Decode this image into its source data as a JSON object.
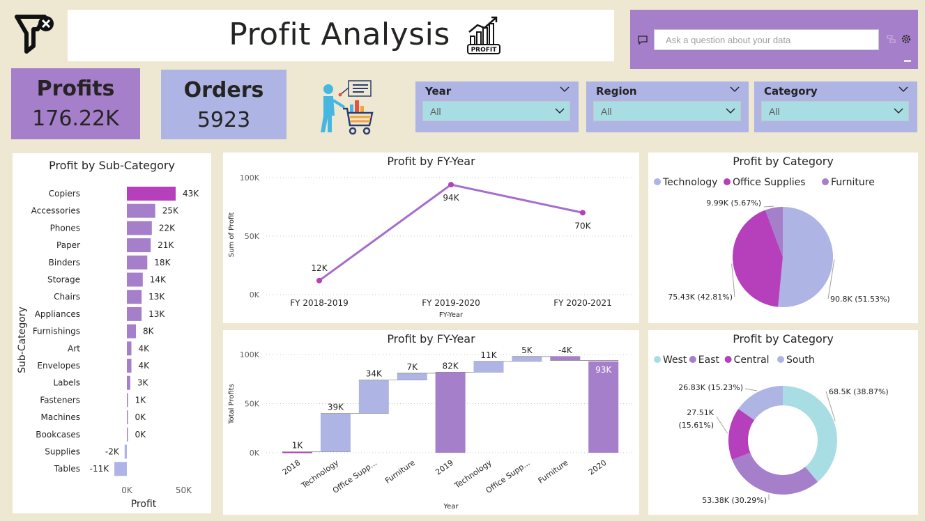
{
  "header": {
    "title": "Profit Analysis",
    "profit_icon_text": "PROFIT"
  },
  "qa": {
    "placeholder": "Ask a question about your data"
  },
  "kpis": {
    "profits": {
      "label": "Profits",
      "value": "176.22K"
    },
    "orders": {
      "label": "Orders",
      "value": "5923"
    }
  },
  "slicers": [
    {
      "label": "Year",
      "value": "All"
    },
    {
      "label": "Region",
      "value": "All"
    },
    {
      "label": "Category",
      "value": "All"
    }
  ],
  "colors": {
    "background": "#eee8d3",
    "purple": "#a67fcb",
    "periwinkle": "#aeb4e4",
    "teal": "#a9dde4",
    "magenta": "#b63fbb",
    "line": "#a66ccf"
  },
  "chart_data": [
    {
      "type": "bar",
      "orientation": "horizontal",
      "title": "Profit by Sub-Category",
      "xlabel": "Profit",
      "ylabel": "Sub-Category",
      "categories": [
        "Copiers",
        "Accessories",
        "Phones",
        "Paper",
        "Binders",
        "Storage",
        "Chairs",
        "Appliances",
        "Furnishings",
        "Art",
        "Envelopes",
        "Labels",
        "Fasteners",
        "Machines",
        "Bookcases",
        "Supplies",
        "Tables"
      ],
      "values": [
        43,
        25,
        22,
        21,
        18,
        14,
        13,
        13,
        8,
        4,
        4,
        3,
        1,
        0,
        0,
        -2,
        -11
      ],
      "data_labels": [
        "43K",
        "25K",
        "22K",
        "21K",
        "18K",
        "14K",
        "13K",
        "13K",
        "8K",
        "4K",
        "4K",
        "3K",
        "1K",
        "0K",
        "0K",
        "-2K",
        "-11K"
      ],
      "x_ticks": [
        "0K",
        "50K"
      ],
      "xlim": [
        -11,
        50
      ]
    },
    {
      "type": "line",
      "title": "Profit by FY-Year",
      "xlabel": "FY-Year",
      "ylabel": "Sum of Profit",
      "categories": [
        "FY 2018-2019",
        "FY 2019-2020",
        "FY 2020-2021"
      ],
      "values": [
        12,
        94,
        70
      ],
      "data_labels": [
        "12K",
        "94K",
        "70K"
      ],
      "y_ticks": [
        "0K",
        "50K",
        "100K"
      ],
      "ylim": [
        0,
        100
      ]
    },
    {
      "type": "pie",
      "title": "Profit by Category",
      "legend": [
        "Technology",
        "Office Supplies",
        "Furniture"
      ],
      "legend_position": "top-left",
      "values": [
        90.8,
        75.43,
        9.99
      ],
      "data_labels": [
        "90.8K (51.53%)",
        "75.43K (42.81%)",
        "9.99K (5.67%)"
      ],
      "colors": [
        "#aeb4e4",
        "#b63fbb",
        "#a67fcb"
      ]
    },
    {
      "type": "bar",
      "subtype": "waterfall",
      "title": "Profit by FY-Year",
      "xlabel": "Year",
      "ylabel": "Total Profits",
      "categories": [
        "2018",
        "Technology",
        "Office Supp...",
        "Furniture",
        "2019",
        "Technology",
        "Office Supp...",
        "Furniture",
        "2020"
      ],
      "values": [
        1,
        39,
        34,
        7,
        82,
        11,
        5,
        -4,
        93
      ],
      "is_total": [
        false,
        false,
        false,
        false,
        true,
        false,
        false,
        false,
        true
      ],
      "data_labels": [
        "1K",
        "39K",
        "34K",
        "7K",
        "82K",
        "11K",
        "5K",
        "-4K",
        "93K"
      ],
      "y_ticks": [
        "0K",
        "50K",
        "100K"
      ],
      "ylim": [
        0,
        100
      ]
    },
    {
      "type": "pie",
      "subtype": "donut",
      "title": "Profit by Category",
      "legend": [
        "West",
        "East",
        "Central",
        "South"
      ],
      "legend_position": "top-left",
      "values": [
        68.5,
        53.38,
        27.51,
        26.83
      ],
      "data_labels": [
        "68.5K (38.87%)",
        "53.38K (30.29%)",
        "27.51K (15.61%)",
        "26.83K (15.23%)"
      ],
      "colors": [
        "#a9dde4",
        "#a67fcb",
        "#b63fbb",
        "#aeb4e4"
      ]
    }
  ]
}
